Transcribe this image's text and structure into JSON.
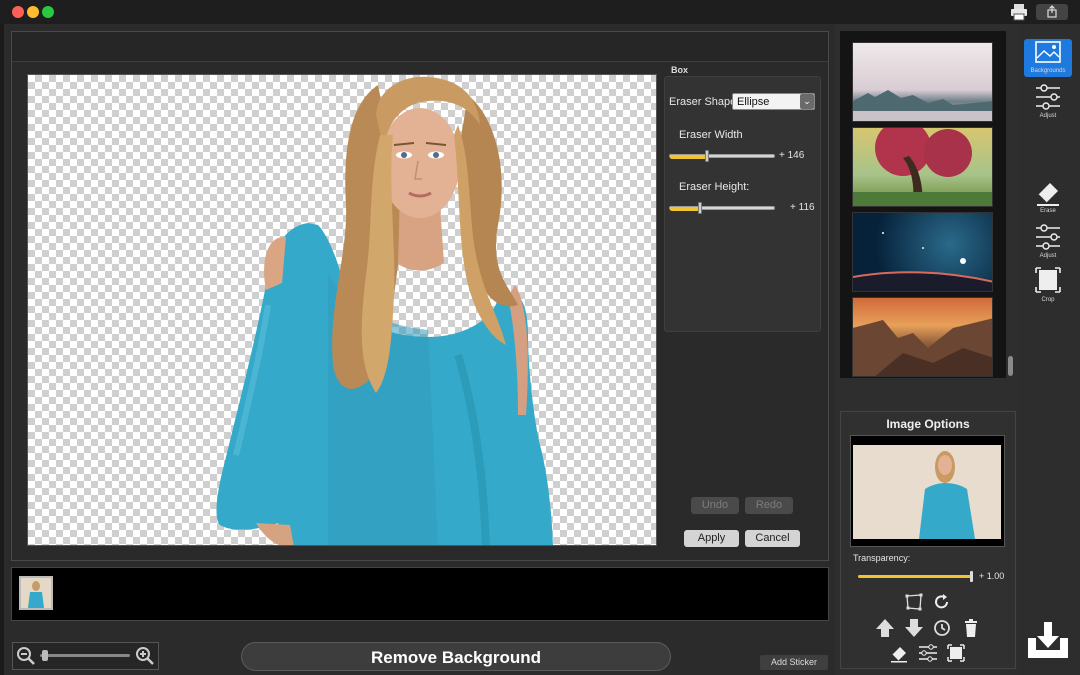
{
  "colors": {
    "accent": "#f1c232",
    "selected_tool": "#1f7ae0"
  },
  "box": {
    "title": "Box",
    "eraser_shape_label": "Eraser Shape",
    "eraser_shape_value": "Ellipse",
    "eraser_width_label": "Eraser Width",
    "eraser_width_value": "+ 146",
    "eraser_width_fraction": 0.36,
    "eraser_height_label": "Eraser Height:",
    "eraser_height_value": "+ 116",
    "eraser_height_fraction": 0.29,
    "undo_label": "Undo",
    "redo_label": "Redo",
    "apply_label": "Apply",
    "cancel_label": "Cancel"
  },
  "bottom": {
    "remove_background_label": "Remove Background",
    "add_sticker_label": "Add Sticker",
    "zoom_level_fraction": 0.05
  },
  "image_options": {
    "title": "Image Options",
    "transparency_label": "Transparency:",
    "transparency_value": "+ 1.00",
    "transparency_fraction": 1.0
  },
  "toolbar": {
    "backgrounds_label": "Backgrounds",
    "adjust_label": "Adjust",
    "erase_label": "Erase",
    "adjust2_label": "Adjust",
    "crop_label": "Crop"
  },
  "icons": {
    "print": "printer-icon",
    "share": "share-icon",
    "zoom_out": "zoom-out-icon",
    "zoom_in": "zoom-in-icon",
    "save": "save-download-icon"
  }
}
